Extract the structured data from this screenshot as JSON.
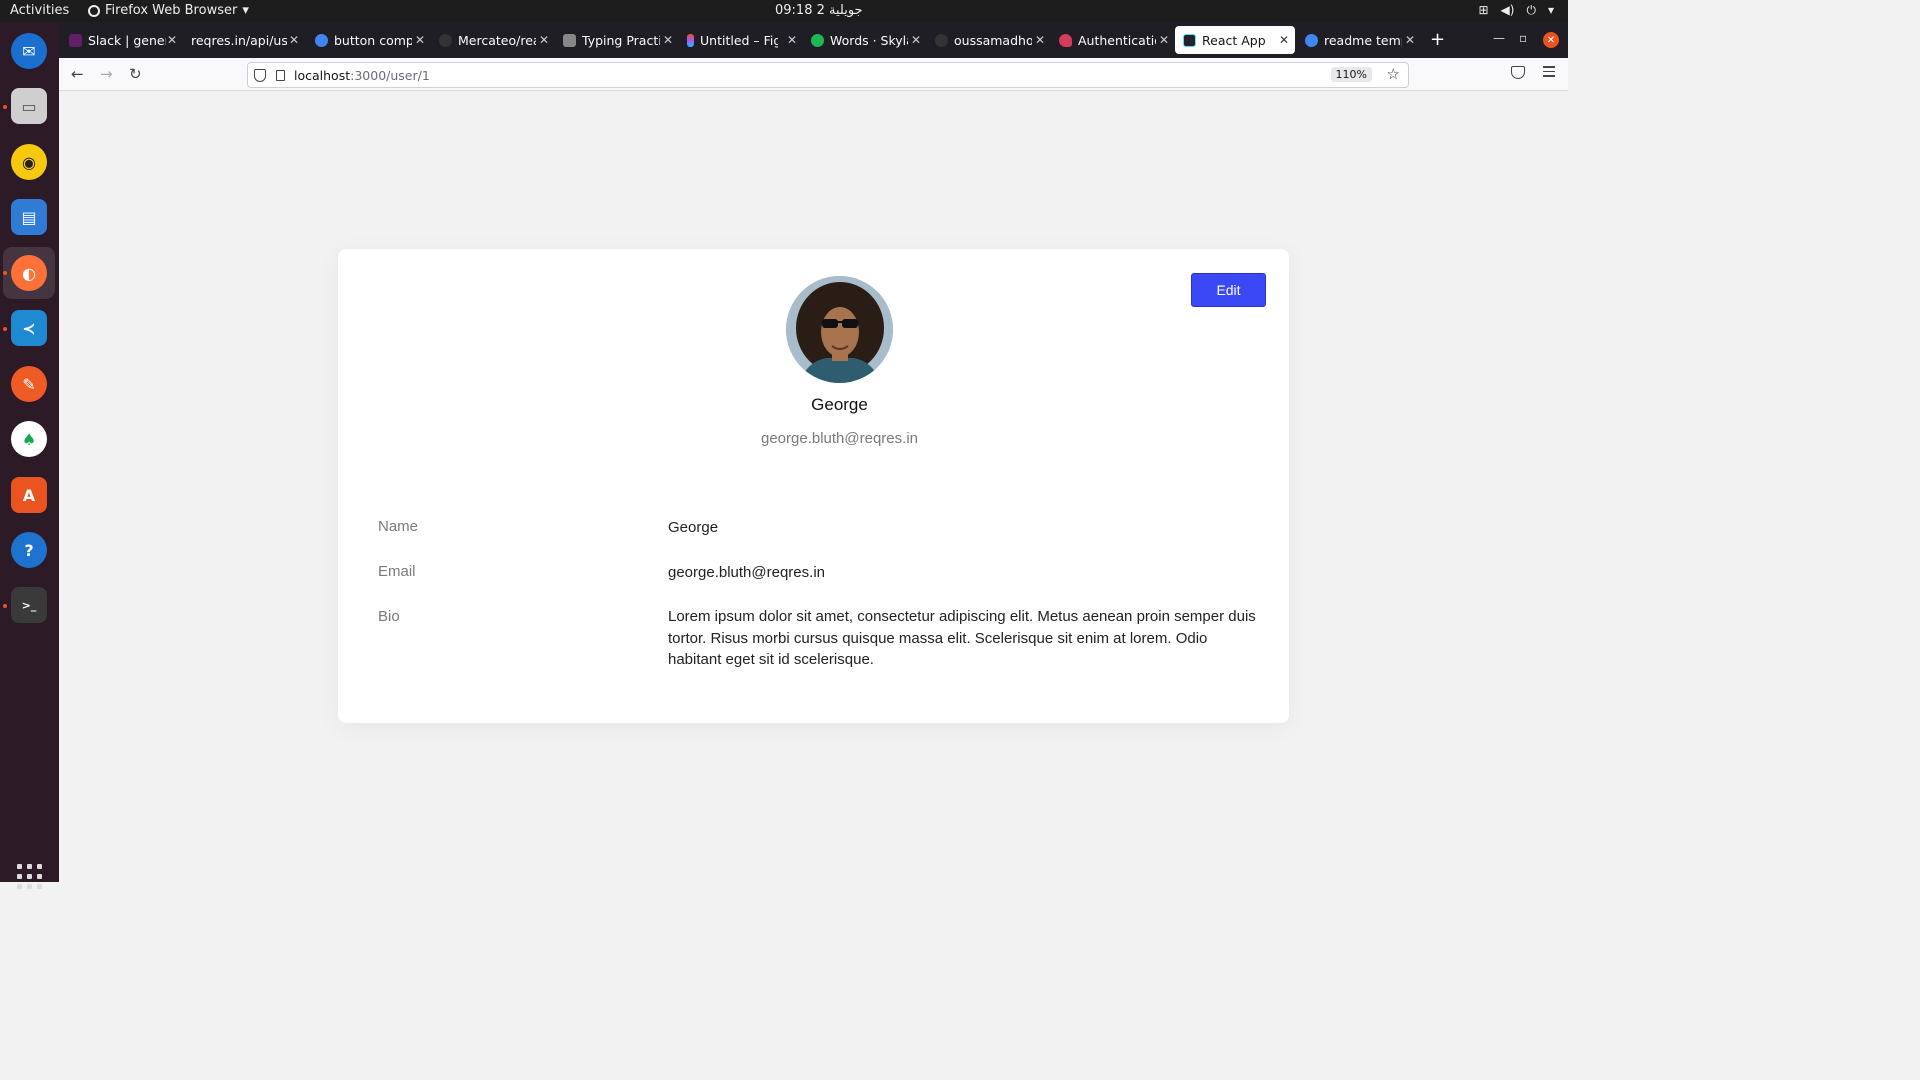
{
  "system": {
    "activities": "Activities",
    "app_name": "Firefox Web Browser",
    "clock": "09:18  2 جويلية"
  },
  "browser": {
    "tabs": [
      {
        "label": "Slack | general",
        "color": "#611f69"
      },
      {
        "label": "reqres.in/api/users",
        "color": "#1f1e25"
      },
      {
        "label": "button component",
        "color": "#4285f4"
      },
      {
        "label": "Mercateo/react",
        "color": "#333333"
      },
      {
        "label": "Typing Practice",
        "color": "#888888"
      },
      {
        "label": "Untitled – Figma",
        "color": "#f24e1e"
      },
      {
        "label": "Words · Skylar",
        "color": "#1db954"
      },
      {
        "label": "oussamadhouib",
        "color": "#333333"
      },
      {
        "label": "Authentication",
        "color": "#d63b5a"
      },
      {
        "label": "React App",
        "color": "#20232a"
      },
      {
        "label": "readme template",
        "color": "#4285f4"
      }
    ],
    "url_host": "localhost",
    "url_path": ":3000/user/1",
    "zoom": "110%"
  },
  "profile": {
    "edit_label": "Edit",
    "name": "George",
    "email": "george.bluth@reqres.in",
    "rows": [
      {
        "label": "Name",
        "value": "George"
      },
      {
        "label": "Email",
        "value": "george.bluth@reqres.in"
      },
      {
        "label": "Bio",
        "value": "Lorem ipsum dolor sit amet, consectetur adipiscing elit. Metus aenean proin semper duis tortor. Risus morbi cursus quisque massa elit. Scelerisque sit enim at lorem. Odio habitant eget sit id scelerisque."
      }
    ]
  },
  "colors": {
    "accent": "#3b48f6",
    "dock": "#2c1a26",
    "tabstrip": "#1f1e25"
  }
}
